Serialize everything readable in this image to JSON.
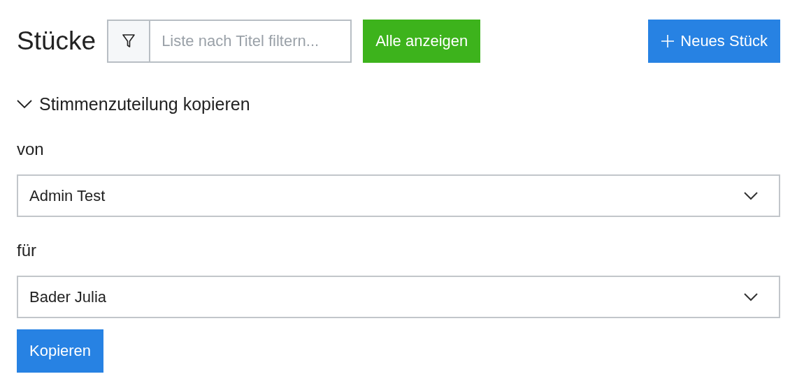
{
  "header": {
    "title": "Stücke",
    "filter": {
      "placeholder": "Liste nach Titel filtern..."
    },
    "show_all_button": "Alle anzeigen",
    "new_button": "Neues Stück"
  },
  "section": {
    "title": "Stimmenzuteilung kopieren",
    "expanded": true,
    "fields": [
      {
        "label": "von",
        "value": "Admin Test"
      },
      {
        "label": "für",
        "value": "Bader Julia"
      }
    ],
    "submit_button": "Kopieren"
  }
}
